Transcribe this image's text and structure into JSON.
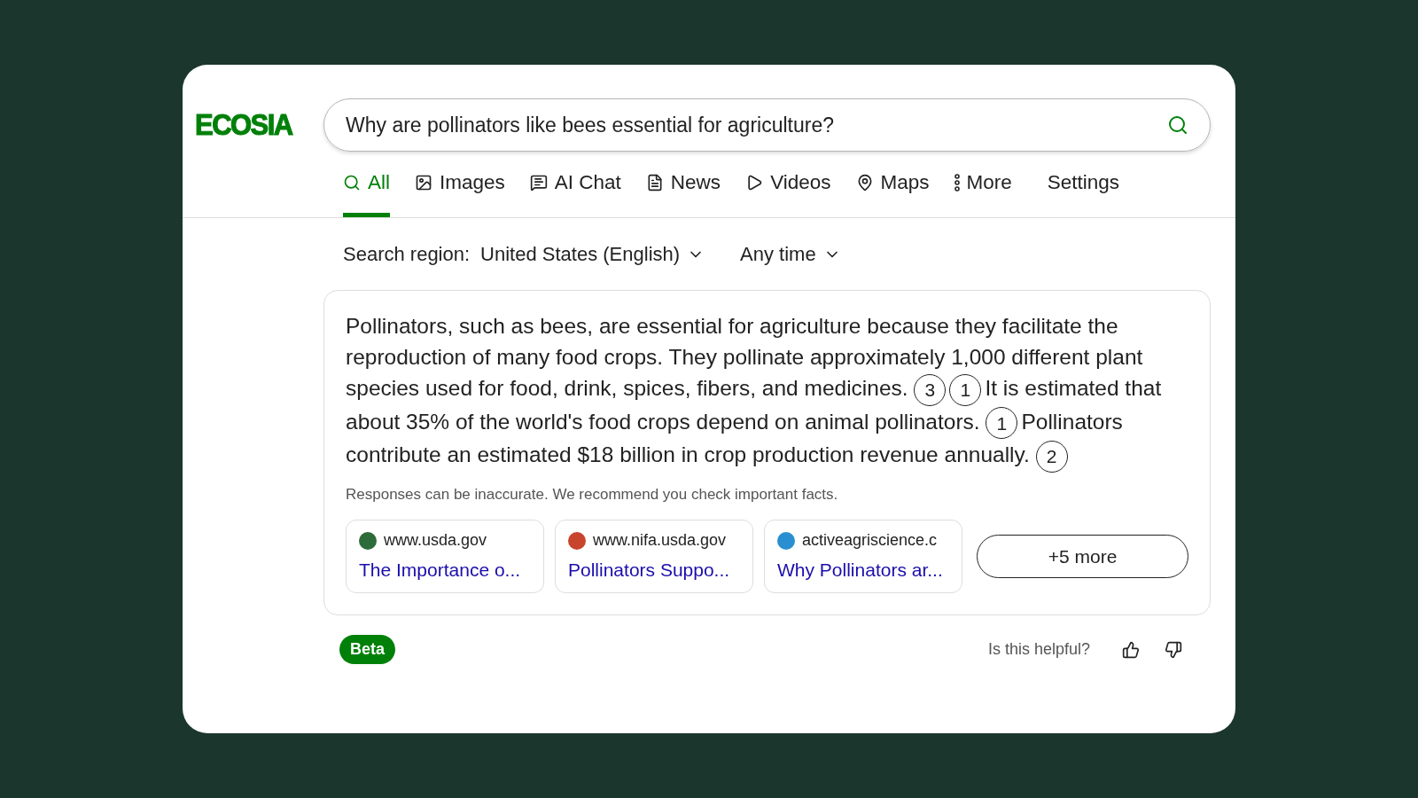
{
  "logo": "ECOSIA",
  "search": {
    "value": "Why are pollinators like bees essential for agriculture?"
  },
  "tabs": [
    {
      "label": "All",
      "kind": "search",
      "selected": true
    },
    {
      "label": "Images",
      "kind": "image",
      "selected": false
    },
    {
      "label": "AI Chat",
      "kind": "chat",
      "selected": false
    },
    {
      "label": "News",
      "kind": "doc",
      "selected": false
    },
    {
      "label": "Videos",
      "kind": "play",
      "selected": false
    },
    {
      "label": "Maps",
      "kind": "pin",
      "selected": false
    },
    {
      "label": "More",
      "kind": "dots",
      "selected": false
    },
    {
      "label": "Settings",
      "kind": "plain",
      "selected": false
    }
  ],
  "filters": {
    "region_label": "Search region:",
    "region": "United States (English)",
    "time": "Any time"
  },
  "answer": {
    "segments": [
      {
        "kind": "text",
        "text": "Pollinators, such as bees, are essential for agriculture because they facilitate the reproduction of many food crops. They pollinate approximately 1,000 different plant species used for food, drink, spices, fibers, and medicines."
      },
      {
        "kind": "cite",
        "text": "3"
      },
      {
        "kind": "cite",
        "text": "1"
      },
      {
        "kind": "text",
        "text": "It is estimated that about 35% of the world's food crops depend on animal pollinators."
      },
      {
        "kind": "cite",
        "text": "1"
      },
      {
        "kind": "text",
        "text": "Pollinators contribute an estimated $18 billion in crop production revenue annually."
      },
      {
        "kind": "cite",
        "text": "2"
      }
    ],
    "disclaimer": "Responses can be inaccurate. We recommend you check important facts.",
    "sources": [
      {
        "site": "www.usda.gov",
        "title": "The Importance o...",
        "color": "#2e6b3a"
      },
      {
        "site": "www.nifa.usda.gov",
        "title": "Pollinators Suppo...",
        "color": "#c8442c"
      },
      {
        "site": "activeagriscience.c",
        "title": "Why Pollinators ar...",
        "color": "#2a8fd0"
      }
    ],
    "more": "+5 more"
  },
  "footer": {
    "badge": "Beta",
    "question": "Is this helpful?"
  }
}
